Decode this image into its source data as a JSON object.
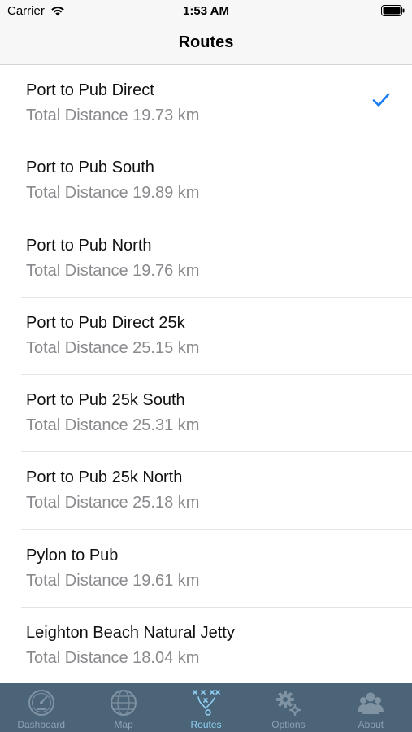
{
  "status_bar": {
    "carrier": "Carrier",
    "time": "1:53 AM"
  },
  "nav": {
    "title": "Routes"
  },
  "routes": [
    {
      "name": "Port to Pub Direct",
      "distance": "Total Distance 19.73 km",
      "selected": true
    },
    {
      "name": "Port to Pub South",
      "distance": "Total Distance 19.89 km",
      "selected": false
    },
    {
      "name": "Port to Pub North",
      "distance": "Total Distance 19.76 km",
      "selected": false
    },
    {
      "name": "Port to Pub Direct 25k",
      "distance": "Total Distance 25.15 km",
      "selected": false
    },
    {
      "name": "Port to Pub 25k South",
      "distance": "Total Distance 25.31 km",
      "selected": false
    },
    {
      "name": "Port to Pub 25k North",
      "distance": "Total Distance 25.18 km",
      "selected": false
    },
    {
      "name": "Pylon to Pub",
      "distance": "Total Distance 19.61 km",
      "selected": false
    },
    {
      "name": "Leighton Beach Natural Jetty",
      "distance": "Total Distance 18.04 km",
      "selected": false
    }
  ],
  "tabs": [
    {
      "label": "Dashboard",
      "icon": "speedometer-icon",
      "active": false
    },
    {
      "label": "Map",
      "icon": "globe-icon",
      "active": false
    },
    {
      "label": "Routes",
      "icon": "routes-play-icon",
      "active": true
    },
    {
      "label": "Options",
      "icon": "gears-icon",
      "active": false
    },
    {
      "label": "About",
      "icon": "people-icon",
      "active": false
    }
  ],
  "colors": {
    "tint": "#1a7cf5",
    "tab_bar": "#4b6478",
    "tab_inactive": "#8ea2b2",
    "tab_active": "#8fd0f2"
  }
}
